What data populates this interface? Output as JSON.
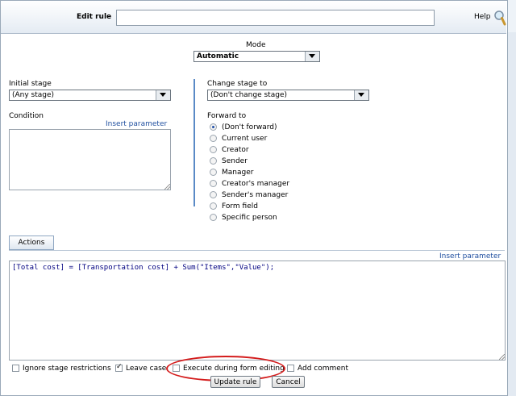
{
  "header": {
    "title": "Edit rule",
    "title_value": "",
    "help_label": "Help"
  },
  "mode": {
    "label": "Mode",
    "value": "Automatic"
  },
  "initial_stage": {
    "label": "Initial stage",
    "value": "(Any stage)"
  },
  "condition": {
    "label": "Condition",
    "insert_link": "Insert parameter",
    "value": ""
  },
  "change_stage": {
    "label": "Change stage to",
    "value": "(Don't change stage)"
  },
  "forward": {
    "label": "Forward to",
    "options": [
      {
        "label": "(Don't forward)",
        "checked": true
      },
      {
        "label": "Current user",
        "checked": false
      },
      {
        "label": "Creator",
        "checked": false
      },
      {
        "label": "Sender",
        "checked": false
      },
      {
        "label": "Manager",
        "checked": false
      },
      {
        "label": "Creator's manager",
        "checked": false
      },
      {
        "label": "Sender's manager",
        "checked": false
      },
      {
        "label": "Form field",
        "checked": false
      },
      {
        "label": "Specific person",
        "checked": false
      }
    ]
  },
  "actions": {
    "tab_label": "Actions",
    "insert_link": "Insert parameter",
    "code": "[Total cost] = [Transportation cost] + Sum(\"Items\",\"Value\");"
  },
  "options": {
    "ignore_stage": {
      "label": "Ignore stage restrictions",
      "checked": false
    },
    "leave_case": {
      "label": "Leave case",
      "checked": true
    },
    "execute_during_editing": {
      "label": "Execute during form editing",
      "checked": false
    },
    "add_comment": {
      "label": "Add comment",
      "checked": false
    }
  },
  "buttons": {
    "update": "Update rule",
    "cancel": "Cancel"
  },
  "colors": {
    "accent_line": "#5a8ac6",
    "highlight_ellipse": "#d41c1c",
    "link": "#2150a0"
  }
}
